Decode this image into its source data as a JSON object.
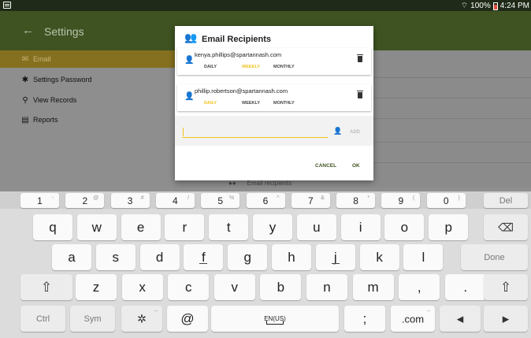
{
  "status_bar": {
    "battery": "100%",
    "time": "4:24 PM"
  },
  "app": {
    "title": "Settings",
    "drawer": [
      {
        "label": "Email",
        "icon": "mail-icon",
        "glyph": "✉",
        "active": true
      },
      {
        "label": "Settings Password",
        "icon": "gear-icon",
        "glyph": "✱",
        "active": false
      },
      {
        "label": "View Records",
        "icon": "search-icon",
        "glyph": "⚲",
        "active": false
      },
      {
        "label": "Reports",
        "icon": "report-icon",
        "glyph": "▤",
        "active": false
      }
    ],
    "peek_text": "Email recipients"
  },
  "dialog": {
    "title": "Email Recipients",
    "recipients": [
      {
        "email": "kenya.phillips@spartannash.com",
        "daily": "DAILY",
        "weekly": "WEEKLY",
        "monthly": "MONTHLY",
        "selected": "weekly"
      },
      {
        "email": "phillip.robertson@spartannash.com",
        "daily": "DAILY",
        "weekly": "WEEKLY",
        "monthly": "MONTHLY",
        "selected": "daily"
      }
    ],
    "add_input_value": "",
    "add_label": "ADD",
    "cancel_label": "CANCEL",
    "ok_label": "OK"
  },
  "colors": {
    "accent": "#f1c21b",
    "primary": "#3f5322",
    "person_icon": "#4caf50"
  },
  "keyboard": {
    "number_row": [
      {
        "k": "1",
        "s": "-"
      },
      {
        "k": "2",
        "s": "@"
      },
      {
        "k": "3",
        "s": "#"
      },
      {
        "k": "4",
        "s": "/"
      },
      {
        "k": "5",
        "s": "%"
      },
      {
        "k": "6",
        "s": "^"
      },
      {
        "k": "7",
        "s": "&"
      },
      {
        "k": "8",
        "s": "*"
      },
      {
        "k": "9",
        "s": "("
      },
      {
        "k": "0",
        "s": ")"
      }
    ],
    "del_label": "Del",
    "row1": [
      "q",
      "w",
      "e",
      "r",
      "t",
      "y",
      "u",
      "i",
      "o",
      "p"
    ],
    "row2": [
      "a",
      "s",
      "d",
      "f",
      "g",
      "h",
      "j",
      "k",
      "l"
    ],
    "row3": [
      "z",
      "x",
      "c",
      "v",
      "b",
      "n",
      "m",
      ",",
      "."
    ],
    "done_label": "Done",
    "ctrl_label": "Ctrl",
    "sym_label": "Sym",
    "at_label": "@",
    "space_label": "EN(US)",
    "semicolon_label": ";",
    "dotcom_label": ".com"
  }
}
